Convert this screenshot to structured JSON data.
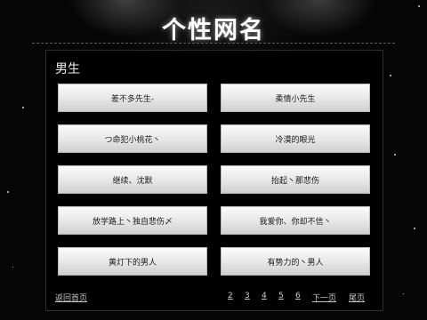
{
  "header": {
    "title": "个性网名"
  },
  "section": {
    "heading": "男生"
  },
  "names": [
    "差不多先生-",
    "柔情小先生",
    "つ命犯小桃花丶",
    "冷漠的眼光",
    "继续、沈默",
    "抬起丶那悲伤",
    "放学路上丶独自悲伤〆",
    "我爱你、你却不信丶",
    "黄灯下的男人",
    "有势力的丶男人"
  ],
  "footer": {
    "back_home": "返回首页",
    "pages": [
      "2",
      "3",
      "4",
      "5",
      "6"
    ],
    "next": "下一页",
    "last": "尾页"
  }
}
